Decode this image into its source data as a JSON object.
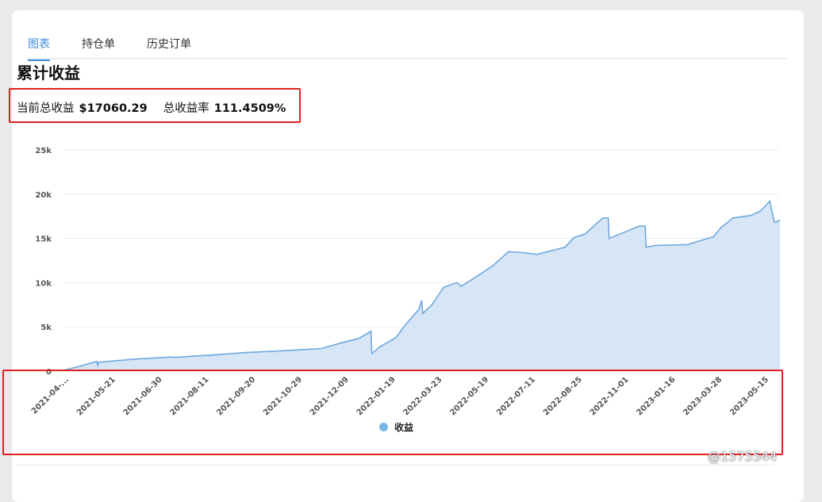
{
  "tabs": [
    {
      "label": "图表"
    },
    {
      "label": "持仓单"
    },
    {
      "label": "历史订单"
    }
  ],
  "title": "累计收益",
  "stats": {
    "profit_label": "当前总收益",
    "profit_value": "$17060.29",
    "rate_label": "总收益率",
    "rate_value": "111.4509%"
  },
  "watermark": "@1575544",
  "colors": {
    "accent": "#3d8bd6",
    "line": "#6fa8dc",
    "fill": "#d6e6f7",
    "highlight_border": "#e0211f"
  },
  "chart_data": {
    "type": "area",
    "ylim": [
      0,
      25000
    ],
    "yticks": [
      "0",
      "5k",
      "10k",
      "15k",
      "20k",
      "25k"
    ],
    "xticks": [
      "2021-04-...",
      "2021-05-21",
      "2021-06-30",
      "2021-08-11",
      "2021-09-20",
      "2021-10-29",
      "2021-12-09",
      "2022-01-19",
      "2022-03-23",
      "2022-05-19",
      "2022-07-11",
      "2022-08-25",
      "2022-11-01",
      "2023-01-16",
      "2023-03-28",
      "2023-05-15"
    ],
    "legend": "收益",
    "legend_position": "bottom",
    "grid": true,
    "series": [
      {
        "name": "收益",
        "points": [
          [
            "2021-04",
            100
          ],
          [
            "2021-05-01",
            500
          ],
          [
            "2021-05-21",
            1100
          ],
          [
            "2021-05-22",
            650
          ],
          [
            "2021-05-23",
            1000
          ],
          [
            "2021-06-30",
            1350
          ],
          [
            "2021-08-11",
            1600
          ],
          [
            "2021-08-12",
            1550
          ],
          [
            "2021-09-20",
            1800
          ],
          [
            "2021-10-29",
            2100
          ],
          [
            "2021-12-09",
            2300
          ],
          [
            "2022-01-19",
            2550
          ],
          [
            "2022-02-10",
            3200
          ],
          [
            "2022-03-01",
            3700
          ],
          [
            "2022-03-14",
            4500
          ],
          [
            "2022-03-15",
            2000
          ],
          [
            "2022-03-23",
            2700
          ],
          [
            "2022-04-10",
            3800
          ],
          [
            "2022-04-20",
            5200
          ],
          [
            "2022-05-05",
            7000
          ],
          [
            "2022-05-08",
            8000
          ],
          [
            "2022-05-09",
            6500
          ],
          [
            "2022-05-19",
            7500
          ],
          [
            "2022-06-01",
            9500
          ],
          [
            "2022-06-15",
            10000
          ],
          [
            "2022-06-20",
            9600
          ],
          [
            "2022-07-11",
            11000
          ],
          [
            "2022-07-25",
            12000
          ],
          [
            "2022-08-10",
            13500
          ],
          [
            "2022-08-25",
            13400
          ],
          [
            "2022-09-10",
            13200
          ],
          [
            "2022-10-10",
            14000
          ],
          [
            "2022-10-20",
            15100
          ],
          [
            "2022-11-01",
            15500
          ],
          [
            "2022-11-20",
            17300
          ],
          [
            "2022-11-26",
            17300
          ],
          [
            "2022-11-27",
            15000
          ],
          [
            "2022-12-30",
            16400
          ],
          [
            "2023-01-05",
            16400
          ],
          [
            "2023-01-06",
            14000
          ],
          [
            "2023-01-16",
            14200
          ],
          [
            "2023-02-20",
            14300
          ],
          [
            "2023-03-20",
            15200
          ],
          [
            "2023-03-28",
            16200
          ],
          [
            "2023-04-10",
            17300
          ],
          [
            "2023-04-30",
            17600
          ],
          [
            "2023-05-10",
            18100
          ],
          [
            "2023-05-20",
            19200
          ],
          [
            "2023-05-25",
            16800
          ],
          [
            "2023-05-31",
            17060
          ]
        ]
      }
    ]
  }
}
